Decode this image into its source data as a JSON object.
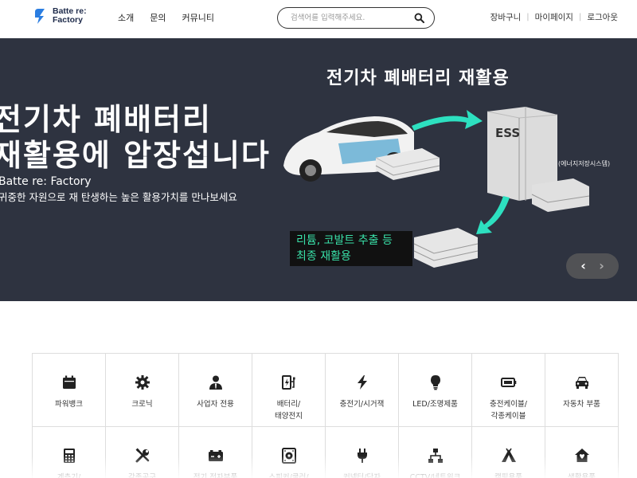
{
  "header": {
    "logo": {
      "line1": "Batte re:",
      "line2": "Factory"
    },
    "nav": [
      "소개",
      "문의",
      "커뮤니티"
    ],
    "search_placeholder": "검색어를 입력해주세요.",
    "util": [
      "장바구니",
      "마이페이지",
      "로그아웃"
    ]
  },
  "banner": {
    "headline_line1": "전기차 폐배터리",
    "headline_line2": "재활용에 압장섭니다",
    "brand": "Batte re: Factory",
    "subtitle": "귀중한 자원으로 재 탄생하는 높은 활용가치를 만나보세요",
    "diagram_title": "전기차 폐배터리 재활용",
    "ess_label": "ESS",
    "ess_caption": "(에너지저장시스템)",
    "recycle_line1": "리튬, 코발트 추출 등",
    "recycle_line2": "최종 재활용",
    "prev": "‹",
    "next": "›"
  },
  "categories": [
    {
      "label": "파워뱅크",
      "icon": "calendar-icon"
    },
    {
      "label": "크로닉",
      "icon": "gear-icon"
    },
    {
      "label": "사업자 전용",
      "icon": "user-tie-icon"
    },
    {
      "label": "배터리/\n태양전지",
      "icon": "battery-charge-icon"
    },
    {
      "label": "충전기/시거잭",
      "icon": "lightning-icon"
    },
    {
      "label": "LED/조명제품",
      "icon": "lightbulb-icon"
    },
    {
      "label": "충전케이블/\n각종케이블",
      "icon": "battery-full-icon"
    },
    {
      "label": "자동차 부품",
      "icon": "car-icon"
    },
    {
      "label": "계측기/\n테스터기",
      "icon": "calculator-icon"
    },
    {
      "label": "각종공구",
      "icon": "tools-icon"
    },
    {
      "label": "전기,전자부품",
      "icon": "car-battery-icon"
    },
    {
      "label": "스피커/쿨러/\n부품",
      "icon": "speaker-icon"
    },
    {
      "label": "커넥터/단자",
      "icon": "plug-icon"
    },
    {
      "label": "CCTV/네트워크",
      "icon": "network-icon"
    },
    {
      "label": "캠핑용품",
      "icon": "tent-icon"
    },
    {
      "label": "생활용품",
      "icon": "house-icon"
    }
  ]
}
